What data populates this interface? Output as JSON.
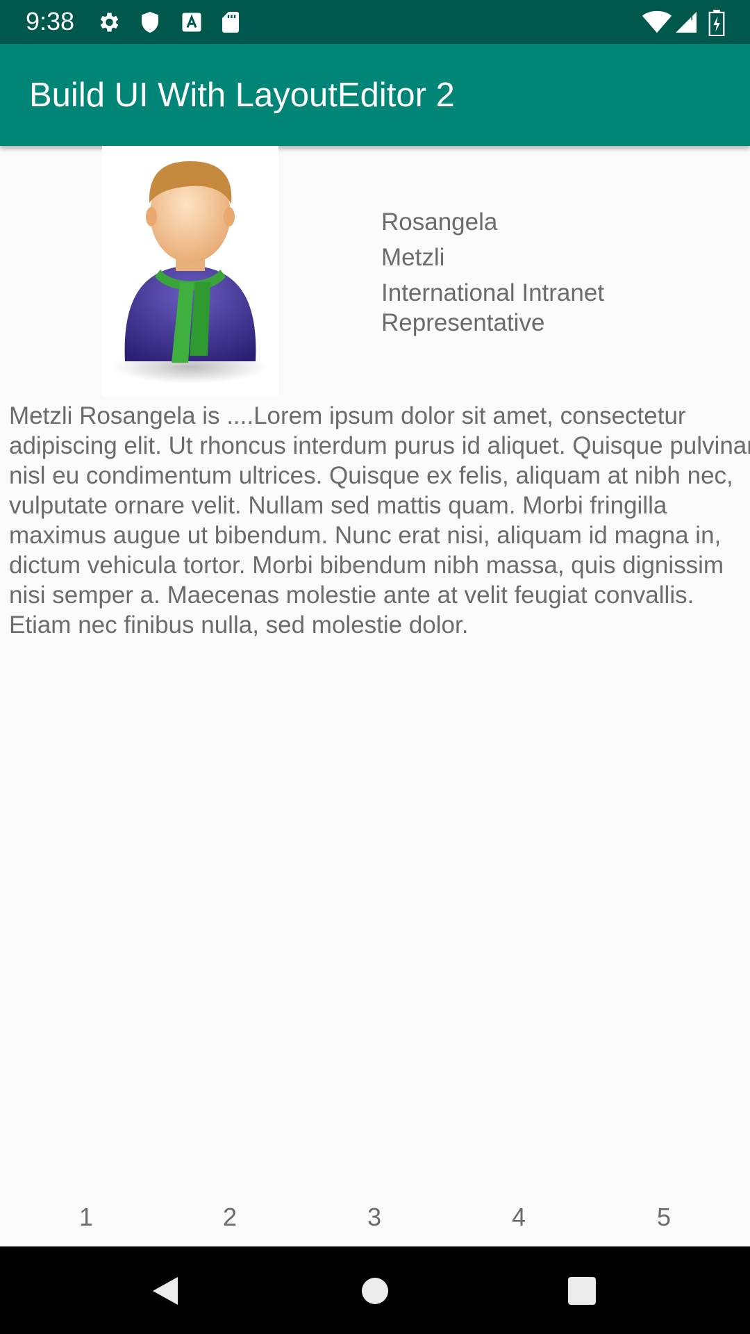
{
  "status_bar": {
    "time": "9:38",
    "icons_left": [
      "gear-icon",
      "shield-icon",
      "a-icon",
      "sd-card-icon"
    ],
    "icons_right": [
      "wifi-icon",
      "signal-icon",
      "battery-icon"
    ],
    "background": "#00574b"
  },
  "app_bar": {
    "title": "Build UI With LayoutEditor 2",
    "background": "#008577"
  },
  "profile": {
    "avatar_icon": "person-avatar-icon",
    "first_name": "Rosangela",
    "last_name": "Metzli",
    "job_title": "International Intranet Representative",
    "bio": "Metzli Rosangela is ....Lorem ipsum dolor sit amet, consectetur adipiscing elit. Ut rhoncus interdum purus id aliquet. Quisque pulvinar nisl eu condimentum ultrices. Quisque ex felis, aliquam at nibh nec, vulputate ornare velit. Nullam sed mattis quam. Morbi fringilla maximus augue ut bibendum. Nunc erat nisi, aliquam id magna in, dictum vehicula tortor. Morbi bibendum nibh massa, quis dignissim nisi semper a. Maecenas molestie ante at velit feugiat convallis. Etiam nec finibus nulla, sed molestie dolor."
  },
  "pager": {
    "items": [
      "1",
      "2",
      "3",
      "4",
      "5"
    ]
  },
  "nav_bar": {
    "buttons": [
      "back-icon",
      "home-icon",
      "recents-icon"
    ]
  }
}
